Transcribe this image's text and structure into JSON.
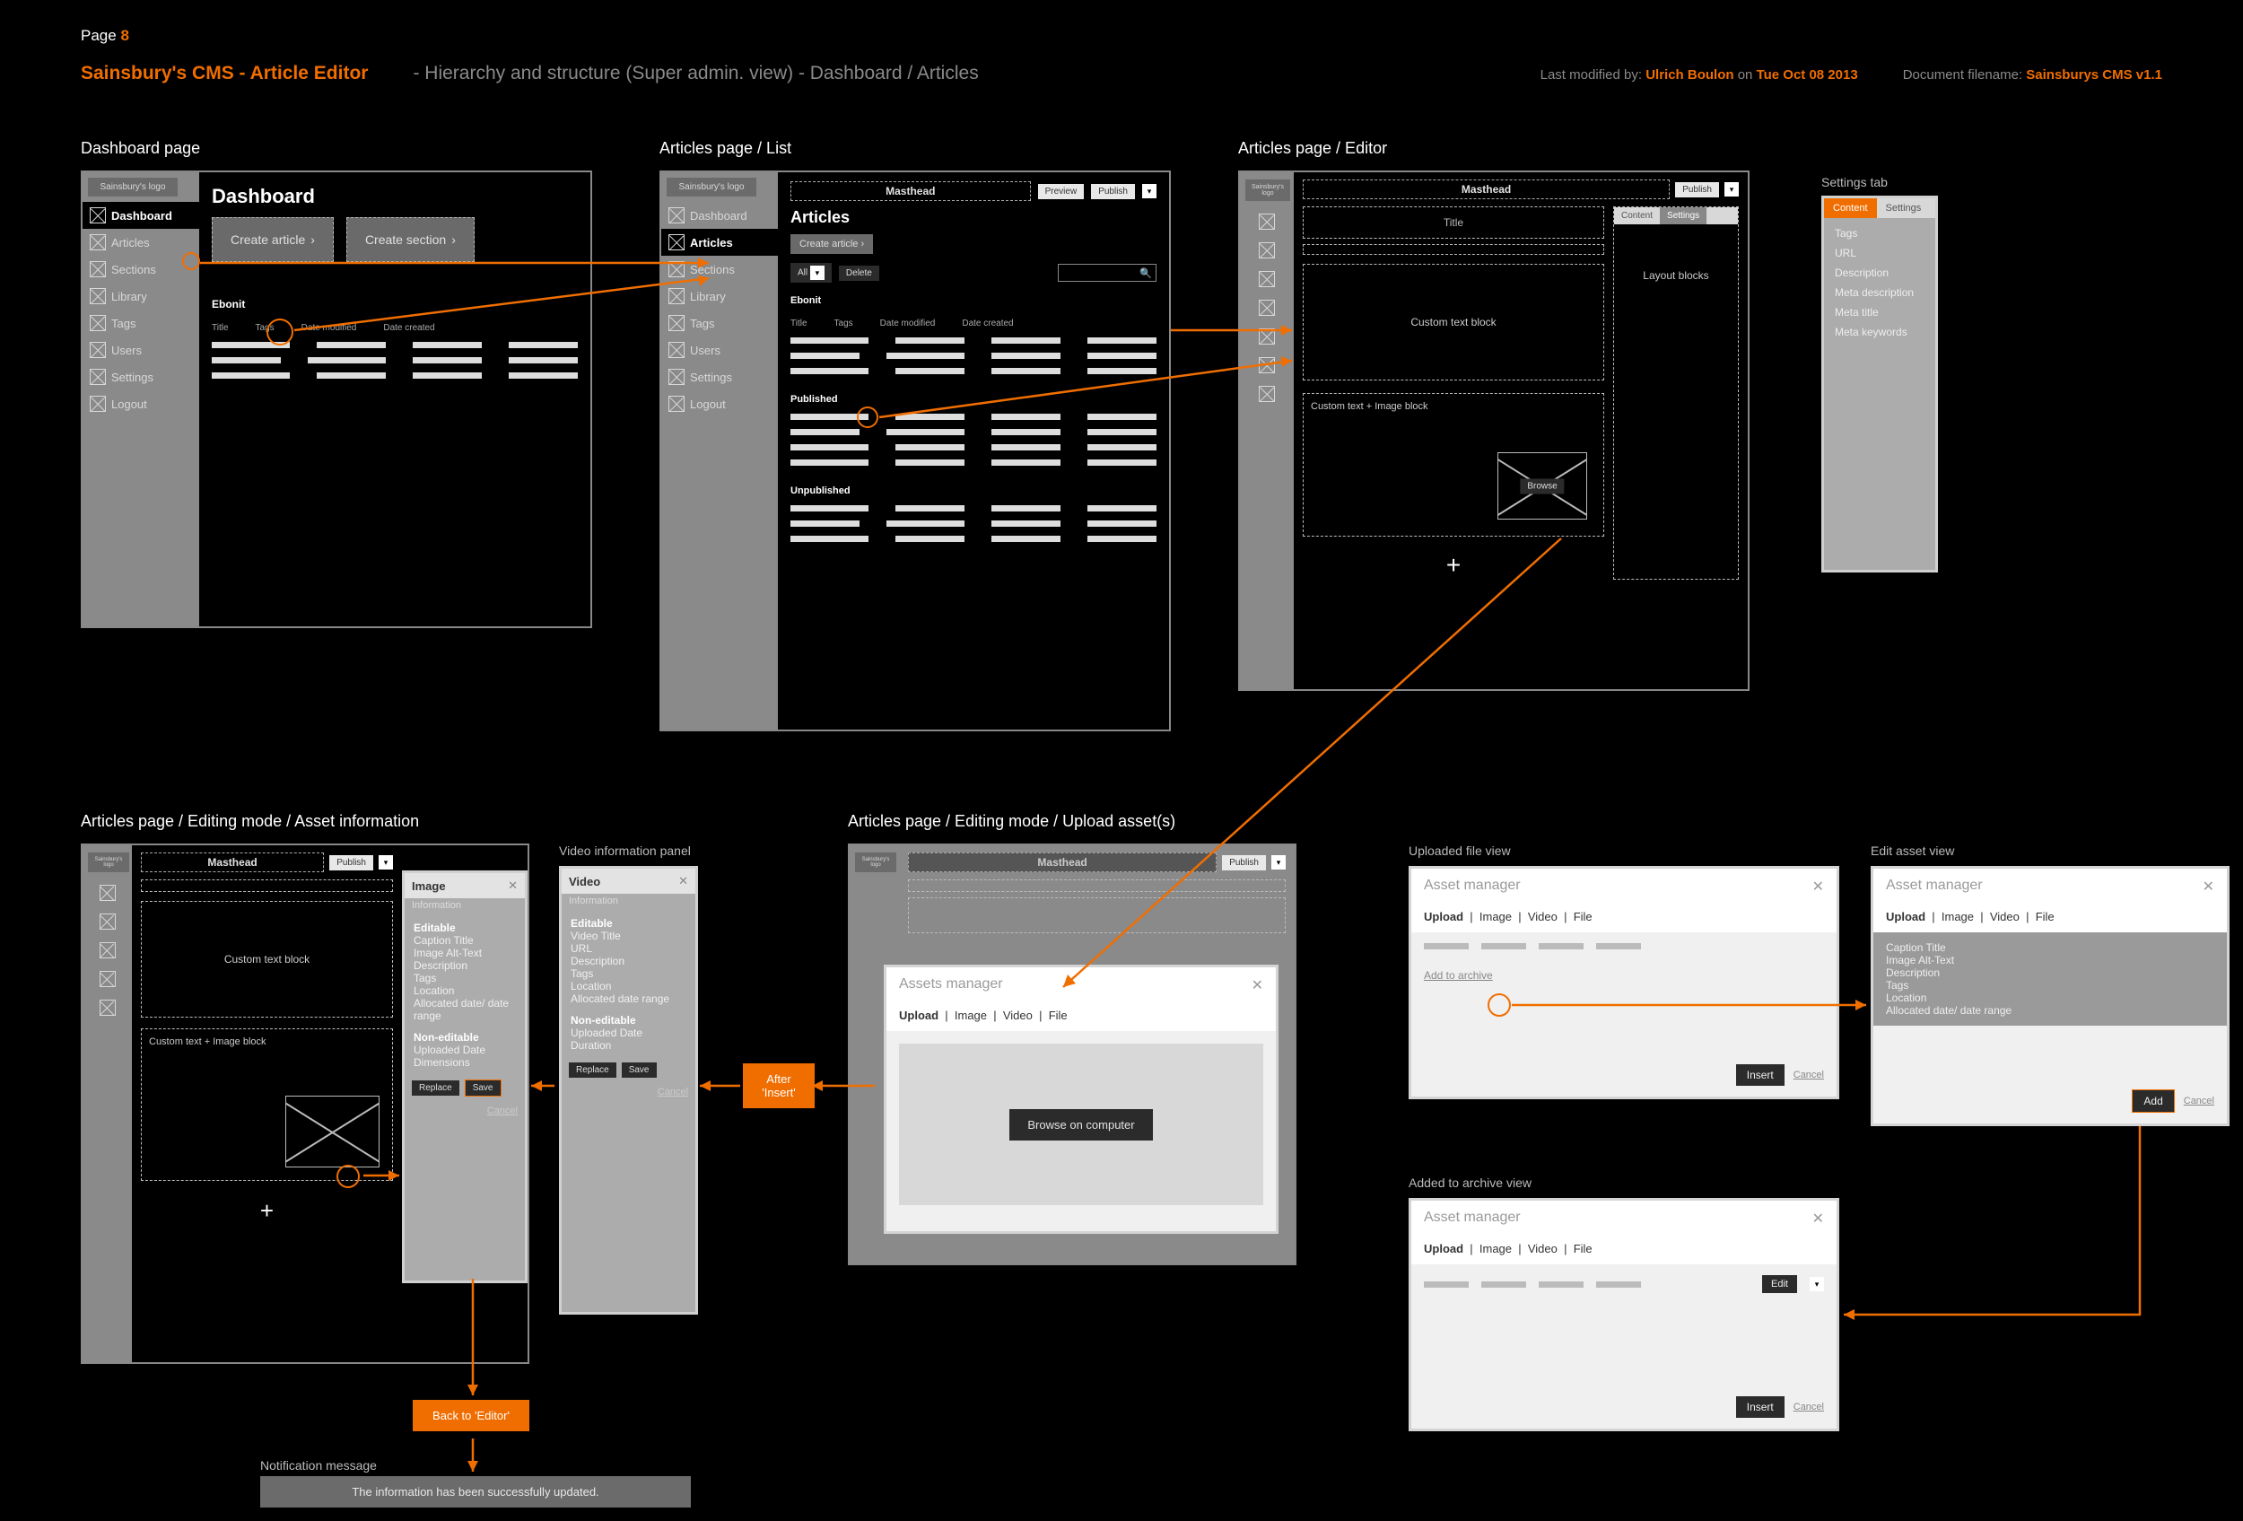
{
  "page": {
    "label": "Page",
    "number": "8"
  },
  "header": {
    "title": "Sainsbury's CMS - Article Editor",
    "dash": " -  ",
    "subtitle": "Hierarchy and structure (Super admin. view) - Dashboard / Articles",
    "modified_label": "Last modified by:",
    "modified_author": "Ulrich Boulon",
    "modified_on_label": "on",
    "modified_date": "Tue Oct 08 2013",
    "filename_label": "Document filename:",
    "filename": "Sainsburys CMS v1.1"
  },
  "sidebar": {
    "logo": "Sainsbury's logo",
    "items": [
      "Dashboard",
      "Articles",
      "Sections",
      "Library",
      "Tags",
      "Users",
      "Settings",
      "Logout"
    ]
  },
  "wf1": {
    "label": "Dashboard page",
    "h1": "Dashboard",
    "create_article": "Create article",
    "create_section": "Create section",
    "section_title": "Ebonit",
    "cols": [
      "Title",
      "Tags",
      "Date modified",
      "Date created"
    ]
  },
  "wf2": {
    "label": "Articles page / List",
    "masthead": "Masthead",
    "h1": "Articles",
    "create_article": "Create article",
    "all": "All",
    "delete": "Delete",
    "preview": "Preview",
    "publish": "Publish",
    "sec1": "Ebonit",
    "cols": [
      "Title",
      "Tags",
      "Date modified",
      "Date created"
    ],
    "sec2": "Published",
    "sec3": "Unpublished"
  },
  "wf3": {
    "label": "Articles page / Editor",
    "masthead": "Masthead",
    "publish": "Publish",
    "title": "Title",
    "custom_text": "Custom text block",
    "custom_text_img": "Custom text + Image block",
    "browse": "Browse",
    "tabs": [
      "Content",
      "Settings"
    ],
    "layout_blocks": "Layout blocks",
    "plus": "+"
  },
  "settings_tab": {
    "label": "Settings tab",
    "tabs": [
      "Content",
      "Settings"
    ],
    "fields": [
      "Tags",
      "URL",
      "Description",
      "Meta description",
      "Meta title",
      "Meta keywords"
    ]
  },
  "wf4": {
    "label": "Articles page / Editing mode / Asset information",
    "masthead": "Masthead",
    "publish": "Publish",
    "custom_text": "Custom text block",
    "custom_text_img": "Custom text + Image block",
    "plus": "+"
  },
  "image_panel": {
    "title": "Image",
    "sub": "Information",
    "editable": "Editable",
    "fields_editable": [
      "Caption Title",
      "Image Alt-Text",
      "Description",
      "Tags",
      "Location",
      "Allocated date/ date range"
    ],
    "noneditable": "Non-editable",
    "fields_non": [
      "Uploaded Date",
      "Dimensions"
    ],
    "replace": "Replace",
    "save": "Save",
    "cancel": "Cancel"
  },
  "video_panel": {
    "label": "Video information panel",
    "title": "Video",
    "sub": "Information",
    "editable": "Editable",
    "fields_editable": [
      "Video Title",
      "URL",
      "Description",
      "Tags",
      "Location",
      "Allocated date range"
    ],
    "noneditable": "Non-editable",
    "fields_non": [
      "Uploaded Date",
      "Duration"
    ],
    "replace": "Replace",
    "save": "Save",
    "cancel": "Cancel"
  },
  "wf5": {
    "label": "Articles page / Editing mode / Upload asset(s)",
    "masthead": "Masthead",
    "publish": "Publish"
  },
  "assets_modal": {
    "title": "Assets manager",
    "tabs": [
      "Upload",
      "Image",
      "Video",
      "File"
    ],
    "browse": "Browse on computer"
  },
  "uploaded_view": {
    "label": "Uploaded file view",
    "title": "Asset manager",
    "tabs": [
      "Upload",
      "Image",
      "Video",
      "File"
    ],
    "add_link": "Add to archive",
    "insert": "Insert",
    "cancel": "Cancel"
  },
  "edit_asset": {
    "label": "Edit asset view",
    "title": "Asset manager",
    "tabs": [
      "Upload",
      "Image",
      "Video",
      "File"
    ],
    "fields": [
      "Caption Title",
      "Image Alt-Text",
      "Description",
      "Tags",
      "Location",
      "Allocated date/ date range"
    ],
    "add": "Add",
    "cancel": "Cancel"
  },
  "added_view": {
    "label": "Added to archive view",
    "title": "Asset manager",
    "tabs": [
      "Upload",
      "Image",
      "Video",
      "File"
    ],
    "edit": "Edit",
    "insert": "Insert",
    "cancel": "Cancel"
  },
  "callouts": {
    "after_insert": "After 'Insert'",
    "back_editor": "Back to 'Editor'"
  },
  "notification": {
    "label": "Notification message",
    "text": "The information has been successfully updated."
  }
}
